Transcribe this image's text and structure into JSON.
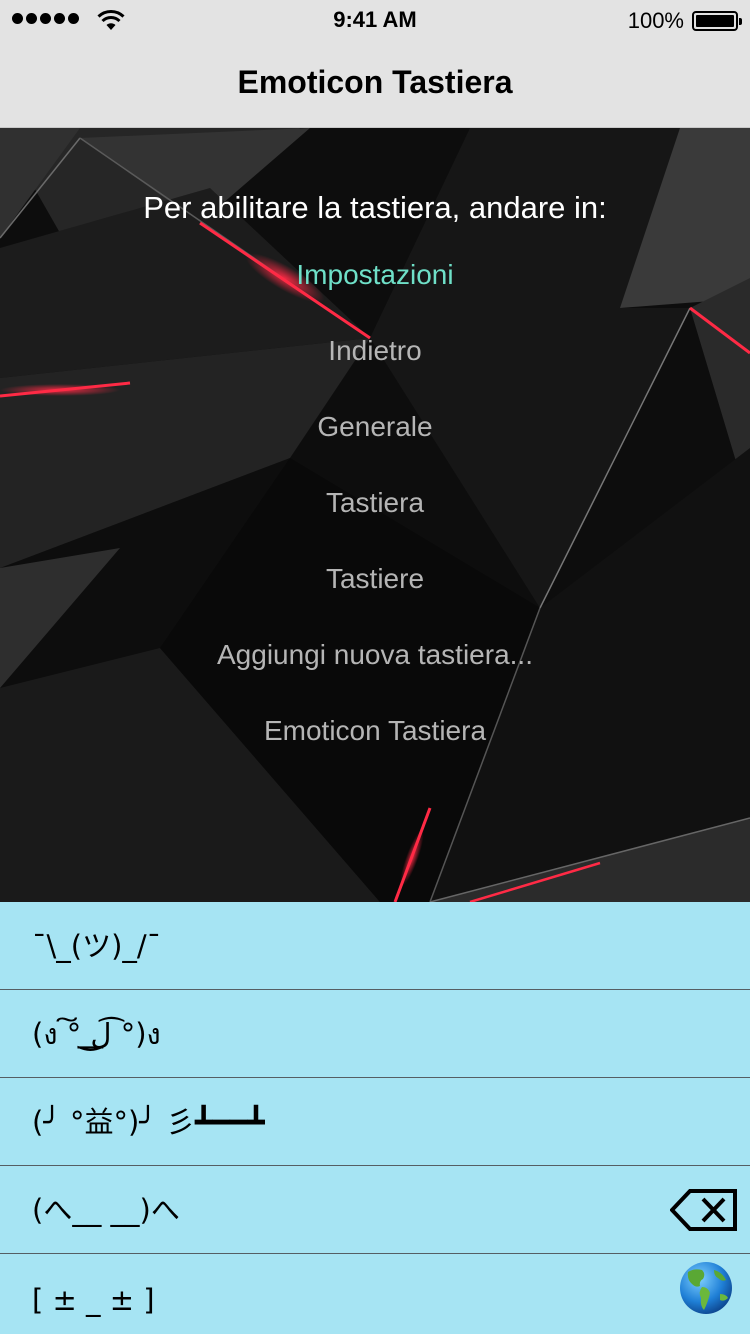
{
  "status_bar": {
    "time": "9:41 AM",
    "battery_percent": "100%",
    "signal_icon": "signal-dots-icon",
    "wifi_icon": "wifi-icon",
    "battery_icon": "battery-icon"
  },
  "nav": {
    "title": "Emoticon Tastiera"
  },
  "instructions": {
    "intro": "Per abilitare la tastiera, andare in:",
    "steps": [
      "Impostazioni",
      "Indietro",
      "Generale",
      "Tastiera",
      "Tastiere",
      "Aggiungi nuova tastiera...",
      "Emoticon Tastiera"
    ],
    "active_color": "#6fe0c8"
  },
  "keyboard": {
    "background_color": "#a6e4f3",
    "emoticons": [
      "¯\\_(ツ)_/¯",
      "(ง ͠° ͟ل͜ ͡°)ง",
      "(╯ °益°)╯ 彡┻━━┻",
      "(へ__ __)へ",
      "[ ± _ ± ]"
    ],
    "delete_icon": "backspace-icon",
    "globe_icon": "globe-icon"
  }
}
